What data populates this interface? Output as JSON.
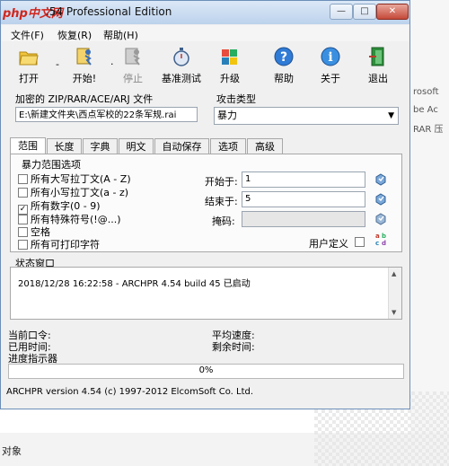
{
  "window": {
    "logo_text": "php中文网",
    "title": ".54 Professional Edition",
    "controls": {
      "minimize": "—",
      "maximize": "□",
      "close": "✕"
    }
  },
  "menu": [
    "文件(F)",
    "恢复(R)",
    "帮助(H)"
  ],
  "toolbar": [
    {
      "label": "打开",
      "icon": "open-folder-icon"
    },
    {
      "label": "开始!",
      "icon": "start-run-icon"
    },
    {
      "label": "停止",
      "icon": "stop-icon",
      "disabled": true
    },
    {
      "label": "基准测试",
      "icon": "stopwatch-icon"
    },
    {
      "label": "升级",
      "icon": "upgrade-icon"
    },
    {
      "label": "帮助",
      "icon": "help-icon"
    },
    {
      "label": "关于",
      "icon": "about-icon"
    },
    {
      "label": "退出",
      "icon": "exit-icon"
    }
  ],
  "toolbar_dots": [
    "-",
    "·"
  ],
  "file_section": {
    "label": "加密的 ZIP/RAR/ACE/ARJ 文件",
    "path": "E:\\新建文件夹\\西点军校的22条军规.rai"
  },
  "attack_section": {
    "label": "攻击类型",
    "selected": "暴力"
  },
  "tabs": [
    "范围",
    "长度",
    "字典",
    "明文",
    "自动保存",
    "选项",
    "高级"
  ],
  "range_panel": {
    "group_label": "暴力范围选项",
    "options": [
      {
        "label": "所有大写拉丁文(A - Z)",
        "checked": false
      },
      {
        "label": "所有小写拉丁文(a - z)",
        "checked": false
      },
      {
        "label": "所有数字(0 - 9)",
        "checked": true
      },
      {
        "label": "所有特殊符号(!@...)",
        "checked": false
      },
      {
        "label": "空格",
        "checked": false
      },
      {
        "label": "所有可打印字符",
        "checked": false
      }
    ],
    "start_label": "开始于:",
    "start_value": "1",
    "end_label": "结束于:",
    "end_value": "5",
    "mask_label": "掩码:",
    "mask_value": "",
    "user_defined_label": "用户定义"
  },
  "status": {
    "label": "状态窗口",
    "lines": [
      "2018/12/28 16:22:58 - ARCHPR 4.54 build 45 已启动"
    ]
  },
  "info": {
    "current_password": "当前口令:",
    "elapsed": "已用时间:",
    "progress_indicator": "进度指示器",
    "avg_speed": "平均速度:",
    "remaining": "剩余时间:"
  },
  "progress": {
    "text": "0%",
    "fraction": 0
  },
  "footer": "ARCHPR version 4.54 (c) 1997-2012 ElcomSoft Co. Ltd.",
  "background": {
    "right_texts": [
      "rosoft",
      "be Ac",
      "RAR 压"
    ],
    "bottom_label": "对象"
  },
  "colors": {
    "title_gradient_top": "#dbe8f7",
    "title_gradient_bottom": "#bcd2ec",
    "logo": "#d0261d"
  }
}
